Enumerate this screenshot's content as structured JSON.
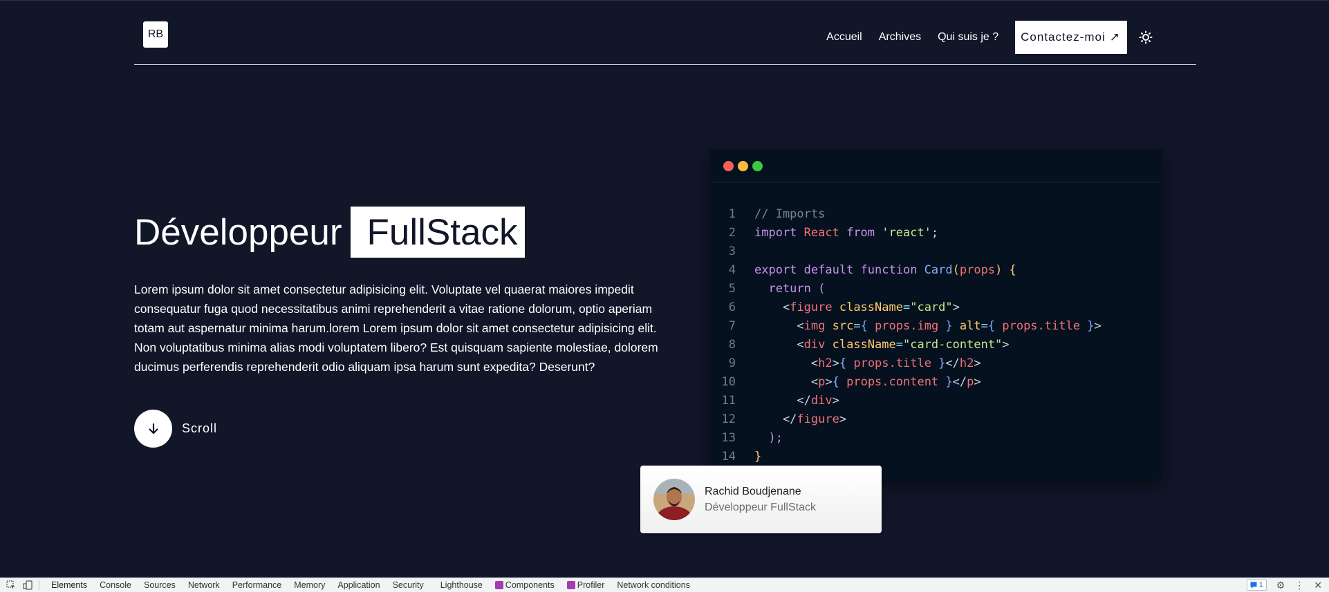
{
  "header": {
    "logo": "RB",
    "nav": [
      "Accueil",
      "Archives",
      "Qui suis je ?"
    ],
    "contact_label": "Contactez-moi",
    "contact_arrow": "↗",
    "theme_icon": "sun-icon"
  },
  "hero": {
    "title_plain": "Développeur",
    "title_highlight": "FullStack",
    "description": "Lorem ipsum dolor sit amet consectetur adipisicing elit. Voluptate vel quaerat maiores impedit consequatur fuga quod necessitatibus animi reprehenderit a vitae ratione dolorum, optio aperiam totam aut aspernatur minima harum.lorem Lorem ipsum dolor sit amet consectetur adipisicing elit. Non voluptatibus minima alias modi voluptatem libero? Est quisquam sapiente molestiae, dolorem ducimus perferendis reprehenderit odio aliquam ipsa harum sunt expedita? Deserunt?",
    "scroll_label": "Scroll"
  },
  "code_window": {
    "dots": [
      "#f5605b",
      "#f8bd3c",
      "#3ec741"
    ],
    "lines": [
      {
        "n": "1",
        "tokens": [
          [
            "// Imports",
            "#7a8494"
          ]
        ]
      },
      {
        "n": "2",
        "tokens": [
          [
            "import",
            "#c792ea"
          ],
          [
            " React ",
            "#f07178"
          ],
          [
            "from",
            "#c792ea"
          ],
          [
            " 'react'",
            "#c3e88d"
          ],
          [
            ";",
            "#c8d3e6"
          ]
        ]
      },
      {
        "n": "3",
        "tokens": []
      },
      {
        "n": "4",
        "tokens": [
          [
            "export",
            "#c792ea"
          ],
          [
            " default ",
            "#c792ea"
          ],
          [
            "function",
            "#c792ea"
          ],
          [
            " Card",
            "#82aaff"
          ],
          [
            "(",
            "#ffcb6b"
          ],
          [
            "props",
            "#f07178"
          ],
          [
            ")",
            "#ffcb6b"
          ],
          [
            " {",
            "#ffcb6b"
          ]
        ]
      },
      {
        "n": "5",
        "tokens": [
          [
            "  return",
            "#c792ea"
          ],
          [
            " (",
            "#c792ea"
          ]
        ]
      },
      {
        "n": "6",
        "tokens": [
          [
            "    <",
            "#c8d3e6"
          ],
          [
            "figure",
            "#f07178"
          ],
          [
            " className",
            "#ffcb6b"
          ],
          [
            "=",
            "#89ddff"
          ],
          [
            "\"card\"",
            "#c3e88d"
          ],
          [
            ">",
            "#c8d3e6"
          ]
        ]
      },
      {
        "n": "7",
        "tokens": [
          [
            "      <",
            "#c8d3e6"
          ],
          [
            "img",
            "#f07178"
          ],
          [
            " src",
            "#ffcb6b"
          ],
          [
            "=",
            "#89ddff"
          ],
          [
            "{ ",
            "#82aaff"
          ],
          [
            "props.img",
            "#f07178"
          ],
          [
            " }",
            "#82aaff"
          ],
          [
            " alt",
            "#ffcb6b"
          ],
          [
            "=",
            "#89ddff"
          ],
          [
            "{ ",
            "#82aaff"
          ],
          [
            "props.title",
            "#f07178"
          ],
          [
            " }",
            "#82aaff"
          ],
          [
            ">",
            "#c8d3e6"
          ]
        ]
      },
      {
        "n": "8",
        "tokens": [
          [
            "      <",
            "#c8d3e6"
          ],
          [
            "div",
            "#f07178"
          ],
          [
            " className",
            "#ffcb6b"
          ],
          [
            "=",
            "#89ddff"
          ],
          [
            "\"card-content\"",
            "#c3e88d"
          ],
          [
            ">",
            "#c8d3e6"
          ]
        ]
      },
      {
        "n": "9",
        "tokens": [
          [
            "        <",
            "#c8d3e6"
          ],
          [
            "h2",
            "#f07178"
          ],
          [
            ">",
            "#c8d3e6"
          ],
          [
            "{ ",
            "#82aaff"
          ],
          [
            "props.title",
            "#f07178"
          ],
          [
            " }",
            "#82aaff"
          ],
          [
            "</",
            "#c8d3e6"
          ],
          [
            "h2",
            "#f07178"
          ],
          [
            ">",
            "#c8d3e6"
          ]
        ]
      },
      {
        "n": "10",
        "tokens": [
          [
            "        <",
            "#c8d3e6"
          ],
          [
            "p",
            "#f07178"
          ],
          [
            ">",
            "#c8d3e6"
          ],
          [
            "{ ",
            "#82aaff"
          ],
          [
            "props.content",
            "#f07178"
          ],
          [
            " }",
            "#82aaff"
          ],
          [
            "</",
            "#c8d3e6"
          ],
          [
            "p",
            "#f07178"
          ],
          [
            ">",
            "#c8d3e6"
          ]
        ]
      },
      {
        "n": "11",
        "tokens": [
          [
            "      </",
            "#c8d3e6"
          ],
          [
            "div",
            "#f07178"
          ],
          [
            ">",
            "#c8d3e6"
          ]
        ]
      },
      {
        "n": "12",
        "tokens": [
          [
            "    </",
            "#c8d3e6"
          ],
          [
            "figure",
            "#f07178"
          ],
          [
            ">",
            "#c8d3e6"
          ]
        ]
      },
      {
        "n": "13",
        "tokens": [
          [
            "  );",
            "#c792ea"
          ]
        ]
      },
      {
        "n": "14",
        "tokens": [
          [
            "}",
            "#ffcb6b"
          ]
        ]
      }
    ]
  },
  "profile": {
    "name": "Rachid Boudjenane",
    "role": "Développeur FullStack"
  },
  "devtools": {
    "tabs": [
      "Elements",
      "Console",
      "Sources",
      "Network",
      "Performance",
      "Memory",
      "Application",
      "Security",
      "Lighthouse",
      "Components",
      "Profiler",
      "Network conditions"
    ],
    "active_tab": "Elements",
    "issues_count": "1"
  }
}
